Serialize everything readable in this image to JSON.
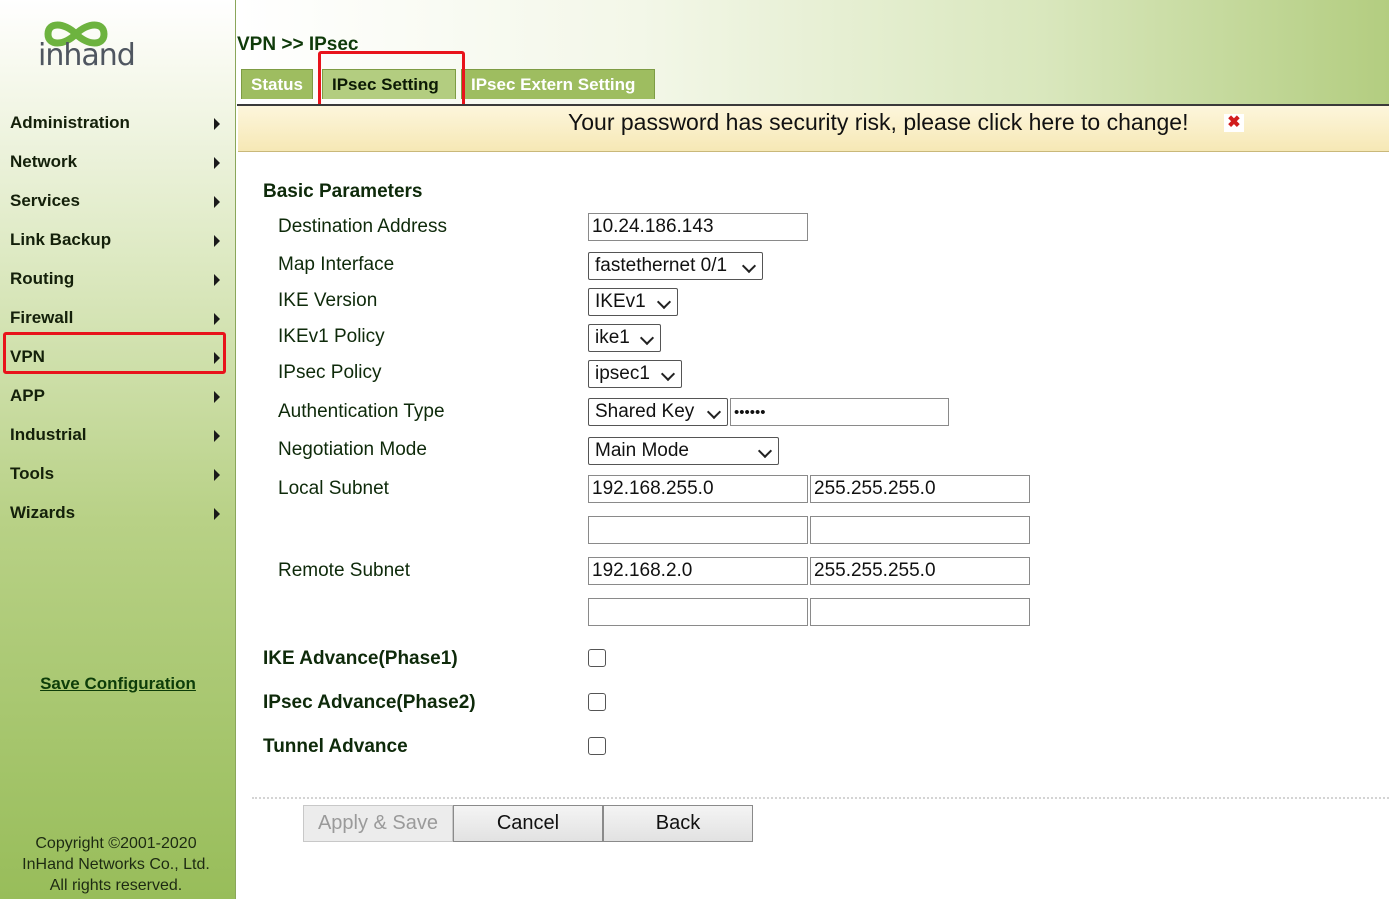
{
  "logo": {
    "text": "inhand"
  },
  "sidebar": {
    "items": [
      {
        "label": "Administration"
      },
      {
        "label": "Network"
      },
      {
        "label": "Services"
      },
      {
        "label": "Link Backup"
      },
      {
        "label": "Routing"
      },
      {
        "label": "Firewall"
      },
      {
        "label": "VPN"
      },
      {
        "label": "APP"
      },
      {
        "label": "Industrial"
      },
      {
        "label": "Tools"
      },
      {
        "label": "Wizards"
      }
    ],
    "save_label": "Save Configuration",
    "copyright": [
      "Copyright ©2001-2020",
      "InHand Networks Co., Ltd.",
      "All rights reserved."
    ]
  },
  "header": {
    "breadcrumb": "VPN >> IPsec",
    "tabs": [
      {
        "label": "Status"
      },
      {
        "label": "IPsec Setting"
      },
      {
        "label": "IPsec Extern Setting"
      }
    ]
  },
  "warning": {
    "text": "Your password has security risk, please click here to change!",
    "close": "✖"
  },
  "form": {
    "section_title": "Basic Parameters",
    "destination_address": {
      "label": "Destination Address",
      "value": "10.24.186.143"
    },
    "map_interface": {
      "label": "Map Interface",
      "value": "fastethernet 0/1"
    },
    "ike_version": {
      "label": "IKE Version",
      "value": "IKEv1"
    },
    "ikev1_policy": {
      "label": "IKEv1 Policy",
      "value": "ike1"
    },
    "ipsec_policy": {
      "label": "IPsec Policy",
      "value": "ipsec1"
    },
    "auth_type": {
      "label": "Authentication Type",
      "value": "Shared Key",
      "key": "••••••"
    },
    "negotiation_mode": {
      "label": "Negotiation Mode",
      "value": "Main Mode"
    },
    "local_subnet": {
      "label": "Local Subnet",
      "ip1": "192.168.255.0",
      "mask1": "255.255.255.0",
      "ip2": "",
      "mask2": ""
    },
    "remote_subnet": {
      "label": "Remote Subnet",
      "ip1": "192.168.2.0",
      "mask1": "255.255.255.0",
      "ip2": "",
      "mask2": ""
    },
    "ike_advance": {
      "label": "IKE Advance(Phase1)"
    },
    "ipsec_advance": {
      "label": "IPsec Advance(Phase2)"
    },
    "tunnel_advance": {
      "label": "Tunnel Advance"
    }
  },
  "buttons": {
    "apply": "Apply & Save",
    "cancel": "Cancel",
    "back": "Back"
  }
}
